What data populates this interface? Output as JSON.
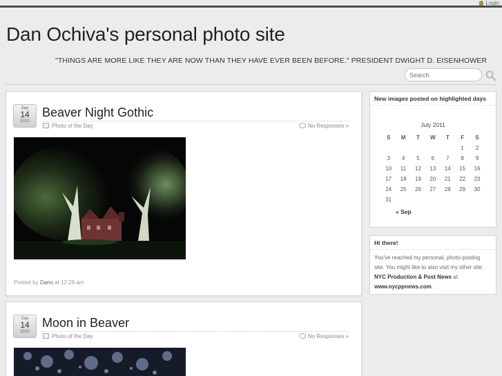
{
  "topbar": {
    "login_label": "Login"
  },
  "header": {
    "site_title": "Dan Ochiva's personal photo site",
    "tagline": "\"THINGS ARE MORE LIKE THEY ARE NOW THAN THEY HAVE EVER BEEN BEFORE.\" PRESIDENT DWIGHT D. EISENHOWER",
    "search_placeholder": "Search"
  },
  "posts": [
    {
      "date": {
        "month": "Sep",
        "day": "14",
        "year": "2010"
      },
      "title": "Beaver Night Gothic",
      "category": "Photo of the Day",
      "responses": "No Responses »",
      "posted_prefix": "Posted by",
      "author": "Dano",
      "time": "at 12:29 am"
    },
    {
      "date": {
        "month": "Sep",
        "day": "14",
        "year": "2010"
      },
      "title": "Moon in Beaver",
      "category": "Photo of the Day",
      "responses": "No Responses »"
    }
  ],
  "sidebar": {
    "calendar_widget": {
      "title": "New images posted on highlighted days",
      "caption": "July 2011",
      "weekdays": [
        "S",
        "M",
        "T",
        "W",
        "T",
        "F",
        "S"
      ],
      "weeks": [
        [
          "",
          "",
          "",
          "",
          "",
          "1",
          "2"
        ],
        [
          "3",
          "4",
          "5",
          "6",
          "7",
          "8",
          "9"
        ],
        [
          "10",
          "11",
          "12",
          "13",
          "14",
          "15",
          "16"
        ],
        [
          "17",
          "18",
          "19",
          "20",
          "21",
          "22",
          "23"
        ],
        [
          "24",
          "25",
          "26",
          "27",
          "28",
          "29",
          "30"
        ],
        [
          "31",
          "",
          "",
          "",
          "",
          "",
          ""
        ]
      ],
      "prev_link": "« Sep"
    },
    "text_widget": {
      "title": "Hi there!",
      "text_1": "You've reached my personal, photo-posting site. You might like to also visit my other site",
      "link_name": "NYC Production & Post News",
      "text_2": "at",
      "link_url_text": "www.nycppnews.com",
      "text_3": "."
    }
  }
}
